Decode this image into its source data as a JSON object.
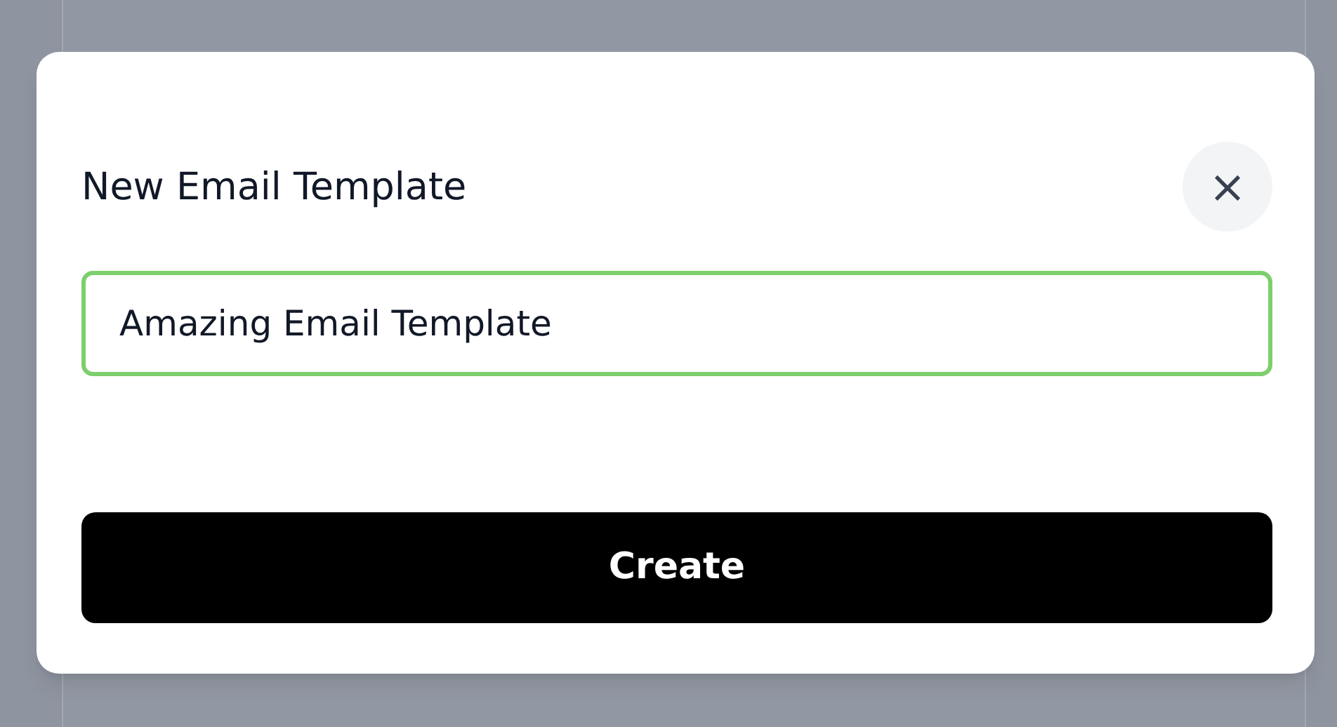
{
  "dialog": {
    "title": "New Email Template",
    "close_button": {
      "label": "×"
    },
    "name_field": {
      "value": "Amazing Email Template",
      "focused": true
    },
    "submit_button": {
      "label": "Create"
    }
  }
}
